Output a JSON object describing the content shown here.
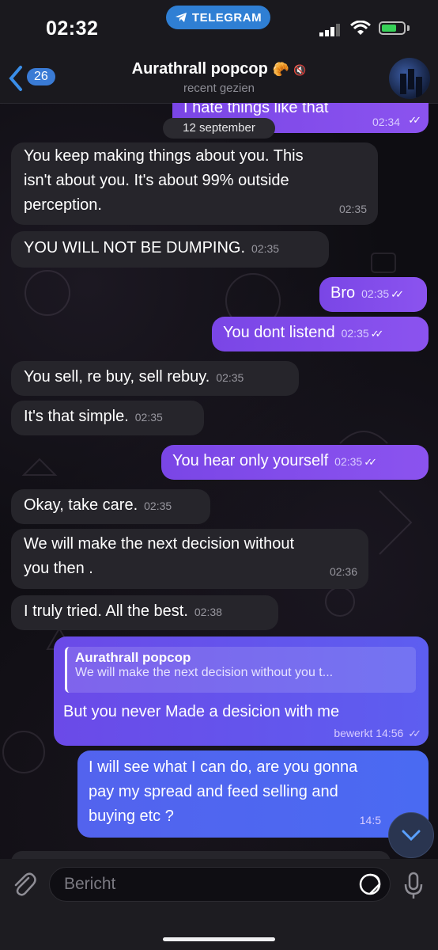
{
  "status_bar": {
    "time": "02:32",
    "app_pill": "TELEGRAM"
  },
  "header": {
    "back_count": "26",
    "title": "Aurathrall popcop",
    "title_emoji": "🥐",
    "subtitle": "recent gezien"
  },
  "date_chip": "12 september",
  "messages": [
    {
      "text": "I hate things like that",
      "time": "02:34",
      "dir": "out"
    },
    {
      "text_lines": [
        "You keep making things about you. This",
        "isn't about you. It's about 99% outside",
        "perception."
      ],
      "time": "02:35",
      "dir": "in"
    },
    {
      "text": "YOU WILL NOT BE DUMPING.",
      "time": "02:35",
      "dir": "in"
    },
    {
      "text": "Bro",
      "time": "02:35",
      "dir": "out"
    },
    {
      "text": "You dont listend",
      "time": "02:35",
      "dir": "out"
    },
    {
      "text": "You sell, re buy, sell rebuy.",
      "time": "02:35",
      "dir": "in"
    },
    {
      "text": "It's that simple.",
      "time": "02:35",
      "dir": "in"
    },
    {
      "text": "You hear only yourself",
      "time": "02:35",
      "dir": "out"
    },
    {
      "text": "Okay, take care.",
      "time": "02:35",
      "dir": "in"
    },
    {
      "text_lines": [
        "We will make the next decision without",
        "you then ."
      ],
      "time": "02:36",
      "dir": "in"
    },
    {
      "text": "I truly tried. All the best.",
      "time": "02:38",
      "dir": "in"
    },
    {
      "reply_name": "Aurathrall popcop",
      "reply_text": "We will make the next decision without you t...",
      "text": "But you never Made a desicion with me",
      "edited": "bewerkt",
      "time": "14:56",
      "dir": "out"
    },
    {
      "text_lines": [
        "I will see what I can do, are you gonna",
        "pay my spread and feed selling and",
        "buying etc ?"
      ],
      "time": "14:5",
      "dir": "out"
    }
  ],
  "composer": {
    "placeholder": "Bericht"
  },
  "colors": {
    "outgoing": "#8b53ef",
    "incoming": "#26252b",
    "accent": "#3a7bd5"
  }
}
